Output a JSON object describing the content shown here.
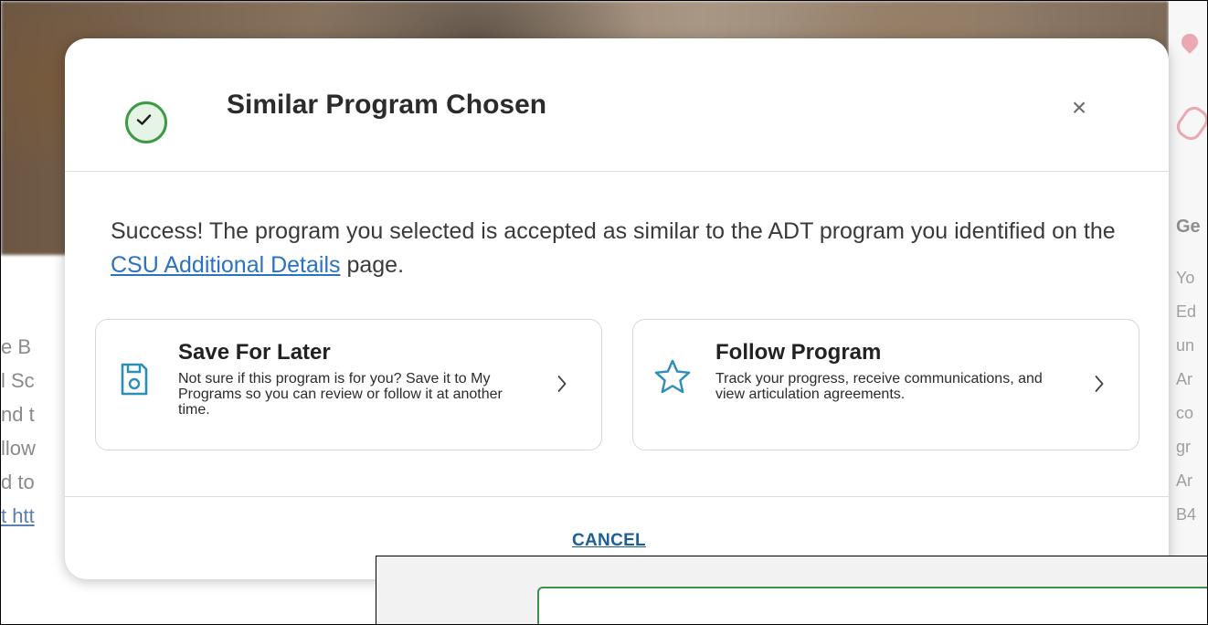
{
  "background": {
    "left_text_fragments": [
      "e B",
      "l Sc",
      "nd t",
      "llow",
      "d to",
      "t htt"
    ],
    "right_heading": "Ge",
    "right_text_fragments": [
      "Yo",
      "Ed",
      "un",
      "Ar",
      "co",
      "gr",
      "Ar",
      "B4"
    ]
  },
  "modal": {
    "title": "Similar Program Chosen",
    "close_label": "×",
    "message_before": "Success! The program you selected is accepted as similar to the ADT program you identified on the ",
    "message_link": "CSU Additional Details",
    "message_after": " page.",
    "cards": [
      {
        "title": "Save For Later",
        "description": "Not sure if this program is for you? Save it to My Programs so you can review or follow it at another time.",
        "icon": "floppy-disk-icon"
      },
      {
        "title": "Follow Program",
        "description": "Track your progress, receive communications, and view articulation agreements.",
        "icon": "star-icon"
      }
    ],
    "cancel_label": "CANCEL"
  },
  "colors": {
    "success_green": "#3b9b45",
    "link_blue": "#2a72c2",
    "icon_teal": "#2a8fb8",
    "cancel_blue": "#1b5f99"
  }
}
